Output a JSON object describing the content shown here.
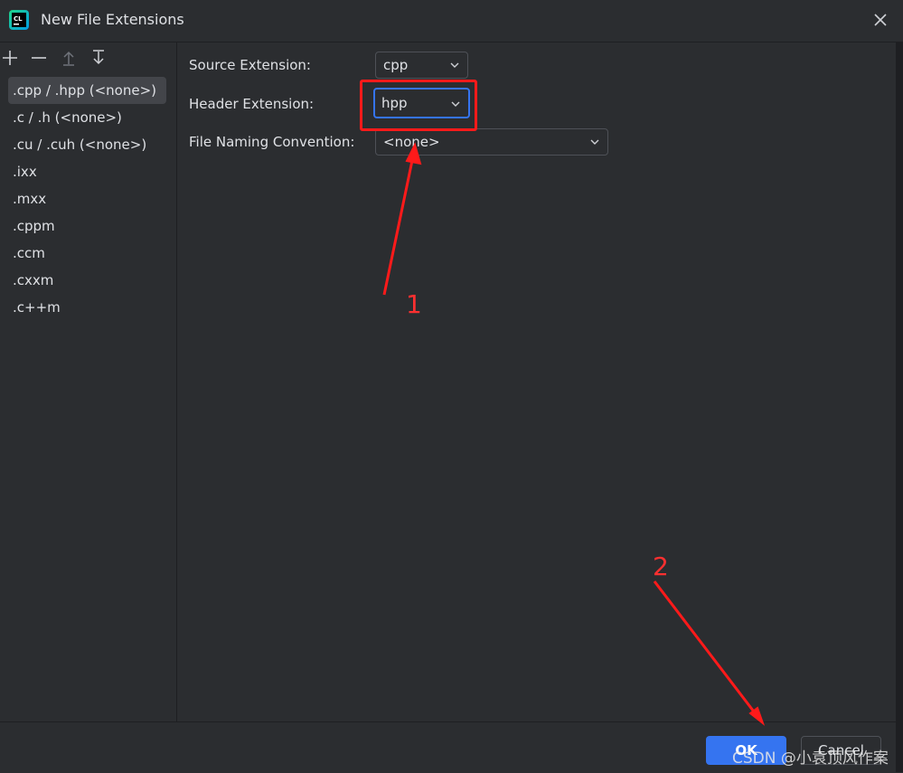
{
  "window": {
    "title": "New File Extensions",
    "app_icon_text": "CL"
  },
  "toolbar": {
    "add_icon": "plus-icon",
    "remove_icon": "minus-icon",
    "move_up_icon": "arrow-up-icon",
    "move_down_icon": "arrow-down-icon"
  },
  "extensions": [
    {
      "label": ".cpp / .hpp (<none>)",
      "selected": true
    },
    {
      "label": ".c / .h (<none>)"
    },
    {
      "label": ".cu / .cuh (<none>)"
    },
    {
      "label": ".ixx"
    },
    {
      "label": ".mxx"
    },
    {
      "label": ".cppm"
    },
    {
      "label": ".ccm"
    },
    {
      "label": ".cxxm"
    },
    {
      "label": ".c++m"
    }
  ],
  "form": {
    "source_label": "Source Extension:",
    "source_value": "cpp",
    "header_label": "Header Extension:",
    "header_value": "hpp",
    "naming_label": "File Naming Convention:",
    "naming_value": "<none>"
  },
  "annotations": {
    "step1": "1",
    "step2": "2",
    "color": "#ff1a1a"
  },
  "footer": {
    "ok_label": "OK",
    "cancel_label": "Cancel"
  },
  "watermark": "CSDN @小袁顶风作案",
  "colors": {
    "background": "#2b2d30",
    "accent": "#3574f0",
    "selection": "#43454a"
  }
}
